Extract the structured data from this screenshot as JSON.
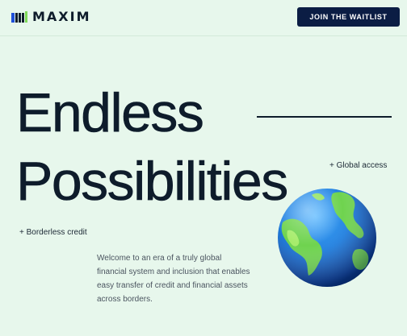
{
  "brand": {
    "name": "MAXIM"
  },
  "header": {
    "cta_label": "JOIN THE WAITLIST"
  },
  "hero": {
    "line1": "Endless",
    "line2": "Possibilities",
    "note_right": "+ Global access",
    "note_left": "+ Borderless credit",
    "description": "Welcome to an era of a truly global financial system and inclusion that enables easy transfer of credit and financial assets across borders."
  },
  "colors": {
    "background": "#e7f7ec",
    "primary_dark": "#0b1d44",
    "text": "#0e1c2b",
    "accent_green": "#7ed957",
    "ocean_blue": "#1f7fe0"
  },
  "icons": {
    "logo": "maxim-logo-icon",
    "globe": "earth-globe-icon"
  }
}
